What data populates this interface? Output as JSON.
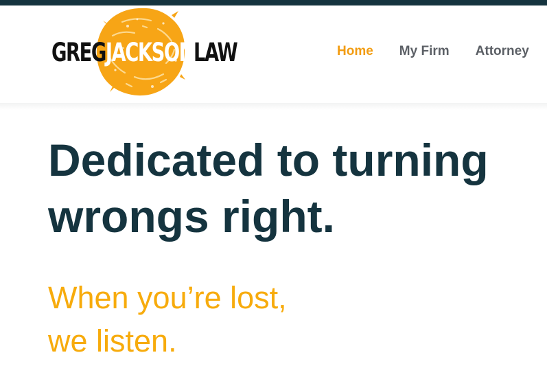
{
  "brand": {
    "logo_part1": "GREG",
    "logo_part2": "JACKSON",
    "logo_part3": "LAW",
    "top_bar_color": "#15343f",
    "splash_color": "#f7a516"
  },
  "nav": {
    "items": [
      {
        "label": "Home",
        "active": true
      },
      {
        "label": "My Firm",
        "active": false
      },
      {
        "label": "Attorney",
        "active": false
      }
    ],
    "active_color": "#f29c11",
    "inactive_color": "#5c6066"
  },
  "hero": {
    "headline_line1": "Dedicated to turning",
    "headline_line2": "wrongs right.",
    "subhead_line1": "When you’re lost,",
    "subhead_line2": "we listen.",
    "headline_color": "#15343f",
    "subhead_color": "#f7ab0c"
  }
}
